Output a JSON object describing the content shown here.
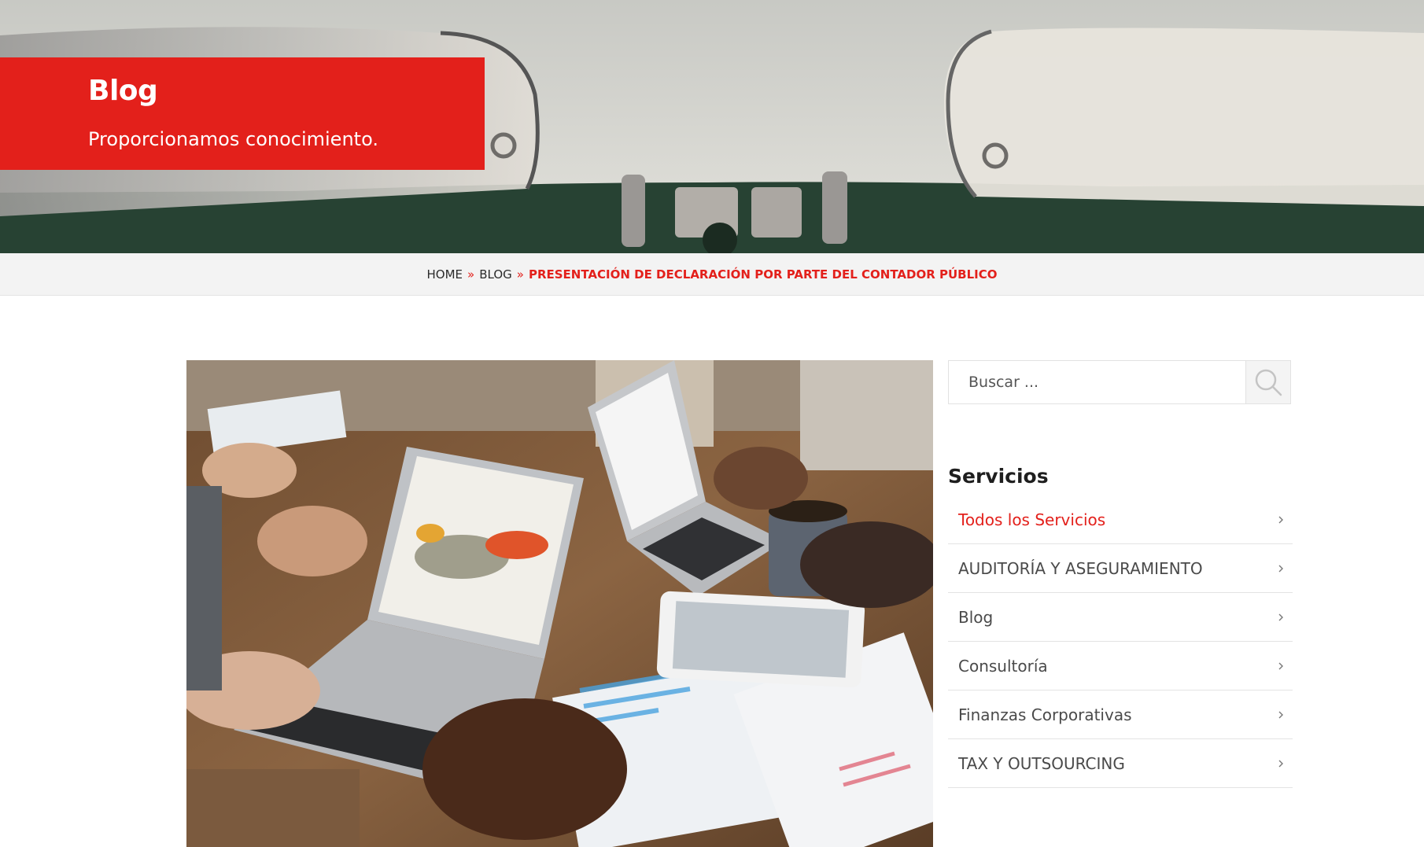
{
  "hero": {
    "title": "Blog",
    "subtitle": "Proporcionamos conocimiento."
  },
  "breadcrumb": {
    "items": [
      "HOME",
      "BLOG"
    ],
    "separator": "»",
    "current": "PRESENTACIÓN DE DECLARACIÓN POR PARTE DEL CONTADOR PÚBLICO"
  },
  "sidebar": {
    "search": {
      "placeholder": "Buscar ...",
      "button_icon": "search-icon"
    },
    "services": {
      "title": "Servicios",
      "items": [
        {
          "label": "Todos los Servicios",
          "active": true
        },
        {
          "label": "AUDITORÍA Y ASEGURAMIENTO",
          "active": false
        },
        {
          "label": "Blog",
          "active": false
        },
        {
          "label": "Consultoría",
          "active": false
        },
        {
          "label": "Finanzas Corporativas",
          "active": false
        },
        {
          "label": "TAX Y OUTSOURCING",
          "active": false
        }
      ],
      "item_icon": "chevron-right-icon"
    }
  },
  "colors": {
    "accent": "#e3201b",
    "breadcrumb_bg": "#f3f3f3"
  }
}
